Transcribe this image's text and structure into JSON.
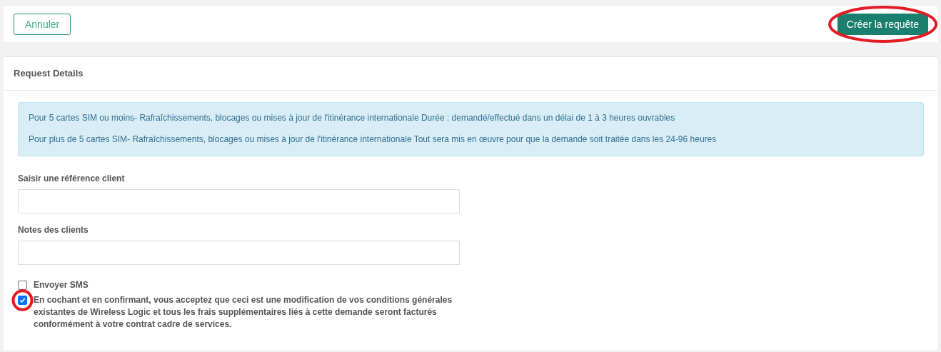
{
  "toolbar": {
    "cancel_button": {
      "label": "Annuler",
      "circled": false
    },
    "submit_button": {
      "label": "Créer la requête",
      "circled": true
    }
  },
  "panel": {
    "title": "Request Details",
    "notices": [
      "Pour 5 cartes SIM ou moins- Rafraîchissements, blocages ou mises à jour de l'itinérance internationale Durée : demandé/effectué dans un délai de 1 à 3 heures ouvrables",
      "Pour plus de 5 cartes SIM- Rafraîchissements, blocages ou mises à jour de l'itinérance internationale Tout sera mis en œuvre pour que la demande soit traitée dans les 24-96 heures"
    ],
    "fields": [
      {
        "label": "Saisir une référence client"
      },
      {
        "label": "Notes des clients"
      }
    ],
    "checkboxes": [
      {
        "label": "Envoyer SMS",
        "checked": false,
        "circled": false
      },
      {
        "label": "En cochant et en confirmant, vous acceptez que ceci est une modification de vos conditions générales existantes de Wireless Logic et tous les frais supplémentaires liés à cette demande seront facturés conformément à votre contrat cadre de services.",
        "checked": true,
        "circled": true
      }
    ]
  }
}
